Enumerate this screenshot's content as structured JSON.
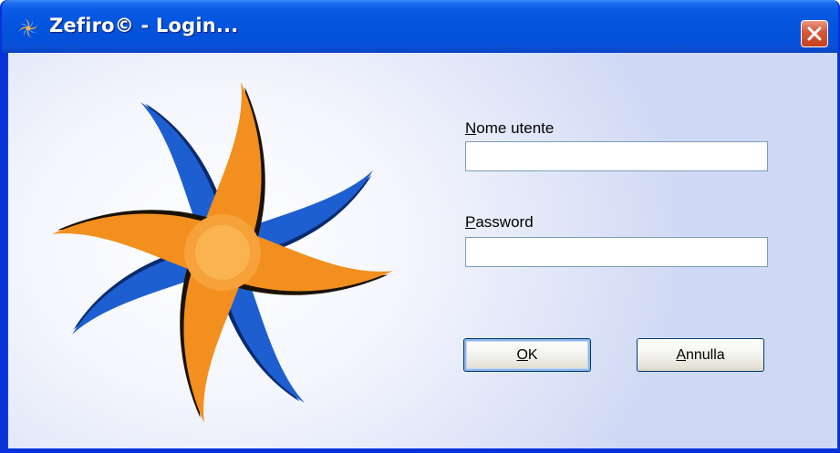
{
  "window": {
    "title": "Zefiro© - Login...",
    "title_icon": "zefiro-star-icon",
    "close_icon": "close-icon"
  },
  "form": {
    "username_label_mnemonic": "N",
    "username_label_rest": "ome utente",
    "username_value": "",
    "password_label_mnemonic": "P",
    "password_label_rest": "assword",
    "password_value": ""
  },
  "buttons": {
    "ok_mnemonic": "O",
    "ok_rest": "K",
    "cancel_mnemonic": "A",
    "cancel_rest": "nnulla"
  },
  "colors": {
    "titlebar": "#0454de",
    "logo_orange": "#f8a33a",
    "logo_blue": "#2f7ce6"
  }
}
